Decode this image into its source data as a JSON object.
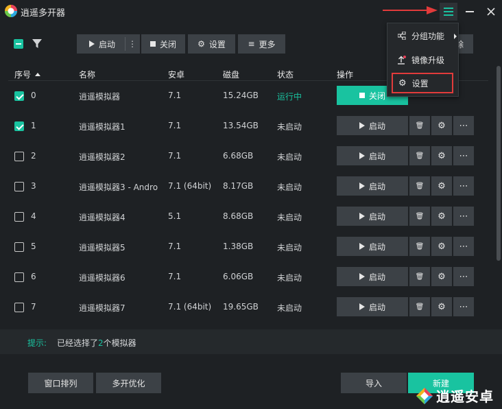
{
  "app": {
    "title": "逍遥多开器"
  },
  "toolbar": {
    "start_label": "启动",
    "more_dots": "⋮",
    "close_label": "关闭",
    "settings_label": "设置",
    "more_label": "更多"
  },
  "table": {
    "headers": {
      "index": "序号",
      "name": "名称",
      "android": "安卓",
      "disk": "磁盘",
      "status": "状态",
      "action": "操作"
    },
    "rows": [
      {
        "index": "0",
        "name": "逍遥模拟器",
        "android": "7.1",
        "disk": "15.24GB",
        "status": "运行中",
        "checked": true,
        "running": true,
        "action_label": "关闭"
      },
      {
        "index": "1",
        "name": "逍遥模拟器1",
        "android": "7.1",
        "disk": "13.54GB",
        "status": "未启动",
        "checked": true,
        "running": false,
        "action_label": "启动"
      },
      {
        "index": "2",
        "name": "逍遥模拟器2",
        "android": "7.1",
        "disk": "6.68GB",
        "status": "未启动",
        "checked": false,
        "running": false,
        "action_label": "启动"
      },
      {
        "index": "3",
        "name": "逍遥模拟器3 - Andro",
        "android": "7.1 (64bit)",
        "disk": "8.17GB",
        "status": "未启动",
        "checked": false,
        "running": false,
        "action_label": "启动"
      },
      {
        "index": "4",
        "name": "逍遥模拟器4",
        "android": "5.1",
        "disk": "8.68GB",
        "status": "未启动",
        "checked": false,
        "running": false,
        "action_label": "启动"
      },
      {
        "index": "5",
        "name": "逍遥模拟器5",
        "android": "7.1",
        "disk": "1.38GB",
        "status": "未启动",
        "checked": false,
        "running": false,
        "action_label": "启动"
      },
      {
        "index": "6",
        "name": "逍遥模拟器6",
        "android": "7.1",
        "disk": "6.06GB",
        "status": "未启动",
        "checked": false,
        "running": false,
        "action_label": "启动"
      },
      {
        "index": "7",
        "name": "逍遥模拟器7",
        "android": "7.1 (64bit)",
        "disk": "19.65GB",
        "status": "未启动",
        "checked": false,
        "running": false,
        "action_label": "启动"
      }
    ]
  },
  "dropdown": {
    "items": [
      {
        "label": "分组功能",
        "icon": "group-icon"
      },
      {
        "label": "镜像升级",
        "icon": "upgrade-icon"
      },
      {
        "label": "设置",
        "icon": "gear-icon"
      }
    ],
    "partial_button_label": "除"
  },
  "footer": {
    "hint_label": "提示:",
    "hint_prefix": "已经选择了",
    "hint_count": "2",
    "hint_suffix": "个模拟器"
  },
  "bottom": {
    "window_arrange": "窗口排列",
    "multi_optimize": "多开优化",
    "import": "导入",
    "new": "新建"
  },
  "watermark": {
    "text": "逍遥安卓"
  },
  "colors": {
    "accent": "#19c3a0",
    "background": "#1e2124",
    "button": "#3c4146",
    "highlight": "#e23b3b"
  }
}
